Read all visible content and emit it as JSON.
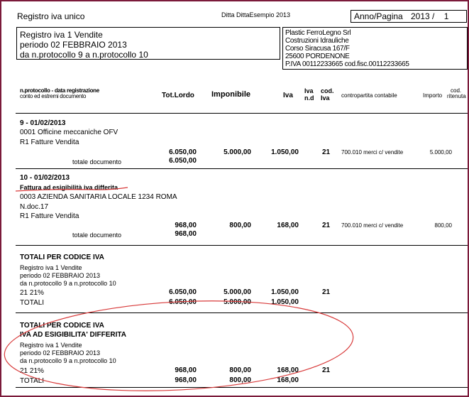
{
  "header": {
    "title": "Registro iva unico",
    "company": "Ditta DittaEsempio 2013",
    "anno_pagina_label": "Anno/Pagina",
    "anno_pagina_value": "2013 /    1"
  },
  "register_box": {
    "line1": "Registro iva 1 Vendite",
    "line2": "periodo 02 FEBBRAIO 2013",
    "line3": "da n.protocollo 9  a n.protocollo 10"
  },
  "company_box": {
    "line1": "Plastic FerroLegno Srl",
    "line2": "Costruzioni Idrauliche",
    "line3": "Corso Siracusa 167/F",
    "line4": "25600 PORDENONE",
    "line5": "P.IVA 00112233665 cod.fisc.00112233665"
  },
  "columns": {
    "protocollo": "n.protocollo - data registrazione",
    "estremi": "conto ed estremi documento",
    "tot_lordo": "Tot.Lordo",
    "imponibile": "Imponibile",
    "iva": "Iva",
    "iva_nd_1": "Iva",
    "iva_nd_2": "n.d",
    "cod_iva_1": "cod.",
    "cod_iva_2": "Iva",
    "contropartita": "contropartita contabile",
    "importo": "Importo",
    "cod_ritenuta_1": "cod.",
    "cod_ritenuta_2": "ritenuta"
  },
  "entry1": {
    "heading": "9 - 01/02/2013",
    "line1": "0001 Officine meccaniche OFV",
    "line2": "R1 Fatture Vendita",
    "tot_lordo": "6.050,00",
    "imponibile": "5.000,00",
    "iva": "1.050,00",
    "cod_iva": "21",
    "contropartita": "700.010 merci c/ vendite",
    "importo": "5.000,00",
    "totale_label": "totale documento",
    "totale_value": "6.050,00"
  },
  "entry2": {
    "heading": "10 - 01/02/2013",
    "subheading": "Fattura ad esigibilità iva differita",
    "line1": "0003 AZIENDA SANITARIA LOCALE 1234 ROMA",
    "line2": "N.doc.17",
    "line3": "R1 Fatture Vendita",
    "tot_lordo": "968,00",
    "imponibile": "800,00",
    "iva": "168,00",
    "cod_iva": "21",
    "contropartita": "700.010 merci c/ vendite",
    "importo": "800,00",
    "totale_label": "totale documento",
    "totale_value": "968,00"
  },
  "totals1": {
    "heading": "TOTALI PER CODICE IVA",
    "line1": "Registro iva 1 Vendite",
    "line2": "periodo 02 FEBBRAIO 2013",
    "line3": "da n.protocollo 9  a n.protocollo 10",
    "code_label": "21 21%",
    "tot_lordo": "6.050,00",
    "imponibile": "5.000,00",
    "iva": "1.050,00",
    "cod_iva": "21",
    "totali_label": "TOTALI",
    "totali_lordo": "6.050,00",
    "totali_imponibile": "5.000,00",
    "totali_iva": "1.050,00"
  },
  "totals2": {
    "heading": "TOTALI PER CODICE IVA",
    "subheading": "IVA AD ESIGIBILITA' DIFFERITA",
    "line1": "Registro iva 1 Vendite",
    "line2": "periodo 02 FEBBRAIO 2013",
    "line3": "da n.protocollo 9  a n.protocollo 10",
    "code_label": "21 21%",
    "tot_lordo": "968,00",
    "imponibile": "800,00",
    "iva": "168,00",
    "cod_iva": "21",
    "totali_label": "TOTALI",
    "totali_lordo": "968,00",
    "totali_imponibile": "800,00",
    "totali_iva": "168,00"
  },
  "colors": {
    "frame": "#7b1a3a",
    "annotation": "#d83a3a"
  }
}
